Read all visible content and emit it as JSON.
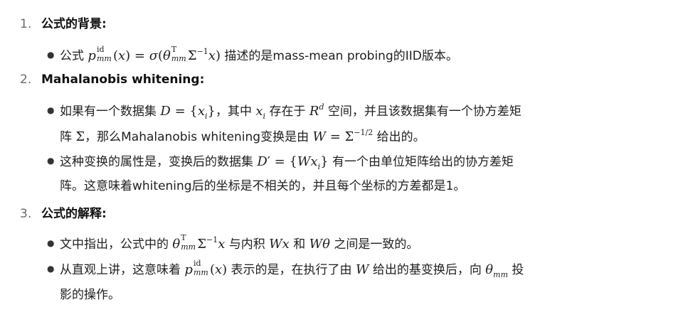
{
  "sections": [
    {
      "number": "1.",
      "heading": "公式的背景",
      "colon": ":",
      "bullets": [
        {
          "text_a": "公式 ",
          "text_b": " 描述的是mass-mean probing的IID版本。"
        }
      ]
    },
    {
      "number": "2.",
      "heading": "Mahalanobis whitening",
      "colon": ":",
      "bullets": [
        {
          "text_a": "如果有一个数据集 ",
          "text_b": "，其中 ",
          "text_c": " 存在于 ",
          "text_d": " 空间，并且该数据集有一个协方差矩",
          "text_e": "阵 ",
          "text_f": "，那么Mahalanobis whitening变换是由 ",
          "text_g": " 给出的。"
        },
        {
          "text_a": "这种变换的属性是，变换后的数据集 ",
          "text_b": " 有一个由单位矩阵给出的协方差矩",
          "text_c": "阵。这意味着whitening后的坐标是不相关的，并且每个坐标的方差都是1。"
        }
      ]
    },
    {
      "number": "3.",
      "heading": "公式的解释",
      "colon": ":",
      "bullets": [
        {
          "text_a": "文中指出，公式中的 ",
          "text_b": " 与内积 ",
          "text_c": " 和 ",
          "text_d": " 之间是一致的。"
        },
        {
          "text_a": "从直观上讲，这意味着 ",
          "text_b": " 表示的是，在执行了由 ",
          "text_c": " 给出的基变换后，向 ",
          "text_d": " 投",
          "text_e": "影的操作。"
        }
      ]
    }
  ]
}
